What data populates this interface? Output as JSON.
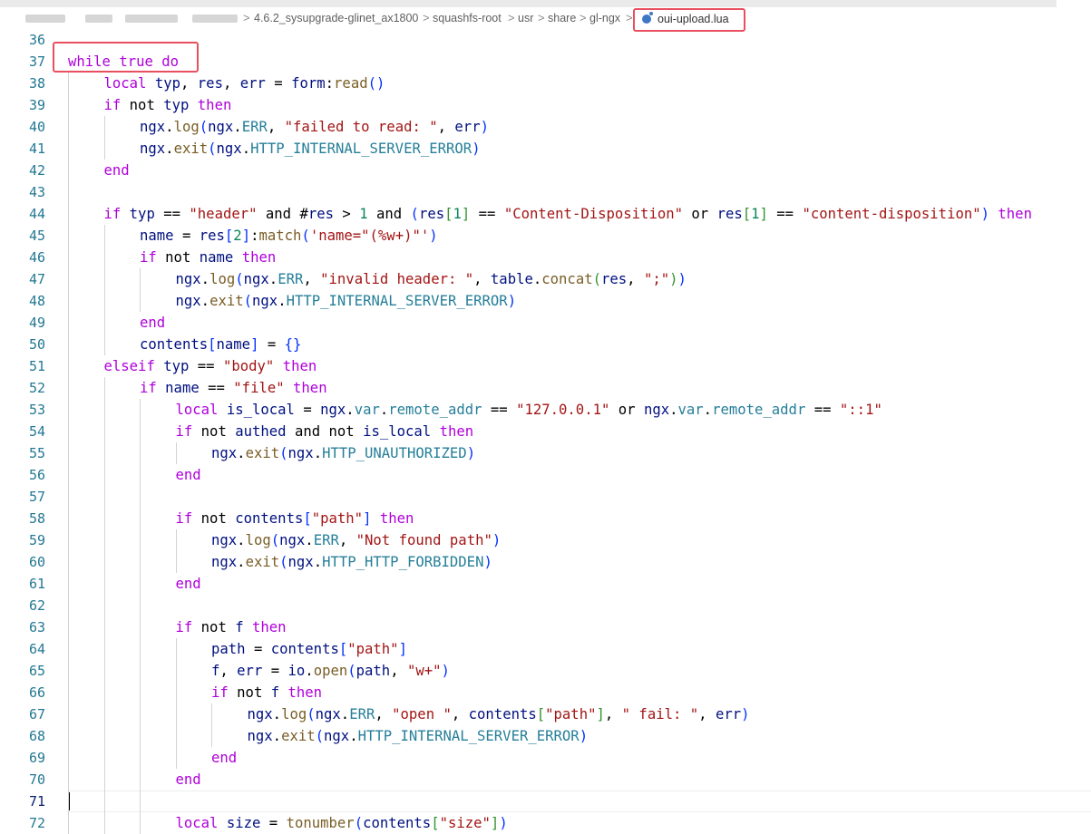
{
  "breadcrumb": {
    "items": [
      "4.6.2_sysupgrade-glinet_ax1800",
      "squashfs-root",
      "usr",
      "share",
      "gl-ngx"
    ],
    "file": "oui-upload.lua",
    "separator": ">"
  },
  "editor": {
    "active_line": 71,
    "highlighted_code": "while true do",
    "lines": [
      {
        "n": 36,
        "indent": 0,
        "t": []
      },
      {
        "n": 37,
        "indent": 0,
        "t": [
          [
            "kw",
            "while"
          ],
          [
            "op",
            " "
          ],
          [
            "kw",
            "true"
          ],
          [
            "op",
            " "
          ],
          [
            "kw",
            "do"
          ]
        ]
      },
      {
        "n": 38,
        "indent": 1,
        "t": [
          [
            "kw",
            "local"
          ],
          [
            "var",
            " typ"
          ],
          [
            "op",
            ", "
          ],
          [
            "var",
            "res"
          ],
          [
            "op",
            ", "
          ],
          [
            "var",
            "err"
          ],
          [
            "op",
            " = "
          ],
          [
            "var",
            "form"
          ],
          [
            "op",
            ":"
          ],
          [
            "fn",
            "read"
          ],
          [
            "br1",
            "()"
          ]
        ]
      },
      {
        "n": 39,
        "indent": 1,
        "t": [
          [
            "kw",
            "if"
          ],
          [
            "op",
            " not "
          ],
          [
            "var",
            "typ"
          ],
          [
            "op",
            " "
          ],
          [
            "kw",
            "then"
          ]
        ]
      },
      {
        "n": 40,
        "indent": 2,
        "t": [
          [
            "var",
            "ngx"
          ],
          [
            "op",
            "."
          ],
          [
            "fn",
            "log"
          ],
          [
            "br1",
            "("
          ],
          [
            "var",
            "ngx"
          ],
          [
            "op",
            "."
          ],
          [
            "fld",
            "ERR"
          ],
          [
            "op",
            ", "
          ],
          [
            "str",
            "\"failed to read: \""
          ],
          [
            "op",
            ", "
          ],
          [
            "var",
            "err"
          ],
          [
            "br1",
            ")"
          ]
        ]
      },
      {
        "n": 41,
        "indent": 2,
        "t": [
          [
            "var",
            "ngx"
          ],
          [
            "op",
            "."
          ],
          [
            "fn",
            "exit"
          ],
          [
            "br1",
            "("
          ],
          [
            "var",
            "ngx"
          ],
          [
            "op",
            "."
          ],
          [
            "fld",
            "HTTP_INTERNAL_SERVER_ERROR"
          ],
          [
            "br1",
            ")"
          ]
        ]
      },
      {
        "n": 42,
        "indent": 1,
        "t": [
          [
            "kw",
            "end"
          ]
        ]
      },
      {
        "n": 43,
        "indent": 0,
        "t": []
      },
      {
        "n": 44,
        "indent": 1,
        "t": [
          [
            "kw",
            "if"
          ],
          [
            "var",
            " typ"
          ],
          [
            "op",
            " == "
          ],
          [
            "str",
            "\"header\""
          ],
          [
            "op",
            " and #"
          ],
          [
            "var",
            "res"
          ],
          [
            "op",
            " > "
          ],
          [
            "num",
            "1"
          ],
          [
            "op",
            " and "
          ],
          [
            "br1",
            "("
          ],
          [
            "var",
            "res"
          ],
          [
            "br2",
            "["
          ],
          [
            "num",
            "1"
          ],
          [
            "br2",
            "]"
          ],
          [
            "op",
            " == "
          ],
          [
            "str",
            "\"Content-Disposition\""
          ],
          [
            "op",
            " or "
          ],
          [
            "var",
            "res"
          ],
          [
            "br2",
            "["
          ],
          [
            "num",
            "1"
          ],
          [
            "br2",
            "]"
          ],
          [
            "op",
            " == "
          ],
          [
            "str",
            "\"content-disposition\""
          ],
          [
            "br1",
            ")"
          ],
          [
            "op",
            " "
          ],
          [
            "kw",
            "then"
          ]
        ]
      },
      {
        "n": 45,
        "indent": 2,
        "t": [
          [
            "var",
            "name"
          ],
          [
            "op",
            " = "
          ],
          [
            "var",
            "res"
          ],
          [
            "br1",
            "["
          ],
          [
            "num",
            "2"
          ],
          [
            "br1",
            "]"
          ],
          [
            "op",
            ":"
          ],
          [
            "fn",
            "match"
          ],
          [
            "br1",
            "("
          ],
          [
            "str",
            "'name=\"(%w+)\"'"
          ],
          [
            "br1",
            ")"
          ]
        ]
      },
      {
        "n": 46,
        "indent": 2,
        "t": [
          [
            "kw",
            "if"
          ],
          [
            "op",
            " not "
          ],
          [
            "var",
            "name"
          ],
          [
            "op",
            " "
          ],
          [
            "kw",
            "then"
          ]
        ]
      },
      {
        "n": 47,
        "indent": 3,
        "t": [
          [
            "var",
            "ngx"
          ],
          [
            "op",
            "."
          ],
          [
            "fn",
            "log"
          ],
          [
            "br1",
            "("
          ],
          [
            "var",
            "ngx"
          ],
          [
            "op",
            "."
          ],
          [
            "fld",
            "ERR"
          ],
          [
            "op",
            ", "
          ],
          [
            "str",
            "\"invalid header: \""
          ],
          [
            "op",
            ", "
          ],
          [
            "var",
            "table"
          ],
          [
            "op",
            "."
          ],
          [
            "fn",
            "concat"
          ],
          [
            "br2",
            "("
          ],
          [
            "var",
            "res"
          ],
          [
            "op",
            ", "
          ],
          [
            "str",
            "\";\""
          ],
          [
            "br2",
            ")"
          ],
          [
            "br1",
            ")"
          ]
        ]
      },
      {
        "n": 48,
        "indent": 3,
        "t": [
          [
            "var",
            "ngx"
          ],
          [
            "op",
            "."
          ],
          [
            "fn",
            "exit"
          ],
          [
            "br1",
            "("
          ],
          [
            "var",
            "ngx"
          ],
          [
            "op",
            "."
          ],
          [
            "fld",
            "HTTP_INTERNAL_SERVER_ERROR"
          ],
          [
            "br1",
            ")"
          ]
        ]
      },
      {
        "n": 49,
        "indent": 2,
        "t": [
          [
            "kw",
            "end"
          ]
        ]
      },
      {
        "n": 50,
        "indent": 2,
        "t": [
          [
            "var",
            "contents"
          ],
          [
            "br1",
            "["
          ],
          [
            "var",
            "name"
          ],
          [
            "br1",
            "]"
          ],
          [
            "op",
            " = "
          ],
          [
            "br1",
            "{}"
          ]
        ]
      },
      {
        "n": 51,
        "indent": 1,
        "t": [
          [
            "kw",
            "elseif"
          ],
          [
            "var",
            " typ"
          ],
          [
            "op",
            " == "
          ],
          [
            "str",
            "\"body\""
          ],
          [
            "op",
            " "
          ],
          [
            "kw",
            "then"
          ]
        ]
      },
      {
        "n": 52,
        "indent": 2,
        "t": [
          [
            "kw",
            "if"
          ],
          [
            "var",
            " name"
          ],
          [
            "op",
            " == "
          ],
          [
            "str",
            "\"file\""
          ],
          [
            "op",
            " "
          ],
          [
            "kw",
            "then"
          ]
        ]
      },
      {
        "n": 53,
        "indent": 3,
        "t": [
          [
            "kw",
            "local"
          ],
          [
            "var",
            " is_local"
          ],
          [
            "op",
            " = "
          ],
          [
            "var",
            "ngx"
          ],
          [
            "op",
            "."
          ],
          [
            "fld",
            "var"
          ],
          [
            "op",
            "."
          ],
          [
            "fld",
            "remote_addr"
          ],
          [
            "op",
            " == "
          ],
          [
            "str",
            "\"127.0.0.1\""
          ],
          [
            "op",
            " or "
          ],
          [
            "var",
            "ngx"
          ],
          [
            "op",
            "."
          ],
          [
            "fld",
            "var"
          ],
          [
            "op",
            "."
          ],
          [
            "fld",
            "remote_addr"
          ],
          [
            "op",
            " == "
          ],
          [
            "str",
            "\"::1\""
          ]
        ]
      },
      {
        "n": 54,
        "indent": 3,
        "t": [
          [
            "kw",
            "if"
          ],
          [
            "op",
            " not "
          ],
          [
            "var",
            "authed"
          ],
          [
            "op",
            " and not "
          ],
          [
            "var",
            "is_local"
          ],
          [
            "op",
            " "
          ],
          [
            "kw",
            "then"
          ]
        ]
      },
      {
        "n": 55,
        "indent": 4,
        "t": [
          [
            "var",
            "ngx"
          ],
          [
            "op",
            "."
          ],
          [
            "fn",
            "exit"
          ],
          [
            "br1",
            "("
          ],
          [
            "var",
            "ngx"
          ],
          [
            "op",
            "."
          ],
          [
            "fld",
            "HTTP_UNAUTHORIZED"
          ],
          [
            "br1",
            ")"
          ]
        ]
      },
      {
        "n": 56,
        "indent": 3,
        "t": [
          [
            "kw",
            "end"
          ]
        ]
      },
      {
        "n": 57,
        "indent": 0,
        "t": []
      },
      {
        "n": 58,
        "indent": 3,
        "t": [
          [
            "kw",
            "if"
          ],
          [
            "op",
            " not "
          ],
          [
            "var",
            "contents"
          ],
          [
            "br1",
            "["
          ],
          [
            "str",
            "\"path\""
          ],
          [
            "br1",
            "]"
          ],
          [
            "op",
            " "
          ],
          [
            "kw",
            "then"
          ]
        ]
      },
      {
        "n": 59,
        "indent": 4,
        "t": [
          [
            "var",
            "ngx"
          ],
          [
            "op",
            "."
          ],
          [
            "fn",
            "log"
          ],
          [
            "br1",
            "("
          ],
          [
            "var",
            "ngx"
          ],
          [
            "op",
            "."
          ],
          [
            "fld",
            "ERR"
          ],
          [
            "op",
            ", "
          ],
          [
            "str",
            "\"Not found path\""
          ],
          [
            "br1",
            ")"
          ]
        ]
      },
      {
        "n": 60,
        "indent": 4,
        "t": [
          [
            "var",
            "ngx"
          ],
          [
            "op",
            "."
          ],
          [
            "fn",
            "exit"
          ],
          [
            "br1",
            "("
          ],
          [
            "var",
            "ngx"
          ],
          [
            "op",
            "."
          ],
          [
            "fld",
            "HTTP_HTTP_FORBIDDEN"
          ],
          [
            "br1",
            ")"
          ]
        ]
      },
      {
        "n": 61,
        "indent": 3,
        "t": [
          [
            "kw",
            "end"
          ]
        ]
      },
      {
        "n": 62,
        "indent": 0,
        "t": []
      },
      {
        "n": 63,
        "indent": 3,
        "t": [
          [
            "kw",
            "if"
          ],
          [
            "op",
            " not "
          ],
          [
            "var",
            "f"
          ],
          [
            "op",
            " "
          ],
          [
            "kw",
            "then"
          ]
        ]
      },
      {
        "n": 64,
        "indent": 4,
        "t": [
          [
            "var",
            "path"
          ],
          [
            "op",
            " = "
          ],
          [
            "var",
            "contents"
          ],
          [
            "br1",
            "["
          ],
          [
            "str",
            "\"path\""
          ],
          [
            "br1",
            "]"
          ]
        ]
      },
      {
        "n": 65,
        "indent": 4,
        "t": [
          [
            "var",
            "f"
          ],
          [
            "op",
            ", "
          ],
          [
            "var",
            "err"
          ],
          [
            "op",
            " = "
          ],
          [
            "var",
            "io"
          ],
          [
            "op",
            "."
          ],
          [
            "fn",
            "open"
          ],
          [
            "br1",
            "("
          ],
          [
            "var",
            "path"
          ],
          [
            "op",
            ", "
          ],
          [
            "str",
            "\"w+\""
          ],
          [
            "br1",
            ")"
          ]
        ]
      },
      {
        "n": 66,
        "indent": 4,
        "t": [
          [
            "kw",
            "if"
          ],
          [
            "op",
            " not "
          ],
          [
            "var",
            "f"
          ],
          [
            "op",
            " "
          ],
          [
            "kw",
            "then"
          ]
        ]
      },
      {
        "n": 67,
        "indent": 5,
        "t": [
          [
            "var",
            "ngx"
          ],
          [
            "op",
            "."
          ],
          [
            "fn",
            "log"
          ],
          [
            "br1",
            "("
          ],
          [
            "var",
            "ngx"
          ],
          [
            "op",
            "."
          ],
          [
            "fld",
            "ERR"
          ],
          [
            "op",
            ", "
          ],
          [
            "str",
            "\"open \""
          ],
          [
            "op",
            ", "
          ],
          [
            "var",
            "contents"
          ],
          [
            "br2",
            "["
          ],
          [
            "str",
            "\"path\""
          ],
          [
            "br2",
            "]"
          ],
          [
            "op",
            ", "
          ],
          [
            "str",
            "\" fail: \""
          ],
          [
            "op",
            ", "
          ],
          [
            "var",
            "err"
          ],
          [
            "br1",
            ")"
          ]
        ]
      },
      {
        "n": 68,
        "indent": 5,
        "t": [
          [
            "var",
            "ngx"
          ],
          [
            "op",
            "."
          ],
          [
            "fn",
            "exit"
          ],
          [
            "br1",
            "("
          ],
          [
            "var",
            "ngx"
          ],
          [
            "op",
            "."
          ],
          [
            "fld",
            "HTTP_INTERNAL_SERVER_ERROR"
          ],
          [
            "br1",
            ")"
          ]
        ]
      },
      {
        "n": 69,
        "indent": 4,
        "t": [
          [
            "kw",
            "end"
          ]
        ]
      },
      {
        "n": 70,
        "indent": 3,
        "t": [
          [
            "kw",
            "end"
          ]
        ]
      },
      {
        "n": 71,
        "indent": 0,
        "t": []
      },
      {
        "n": 72,
        "indent": 3,
        "t": [
          [
            "kw",
            "local"
          ],
          [
            "var",
            " size"
          ],
          [
            "op",
            " = "
          ],
          [
            "fn",
            "tonumber"
          ],
          [
            "br1",
            "("
          ],
          [
            "var",
            "contents"
          ],
          [
            "br2",
            "["
          ],
          [
            "str",
            "\"size\""
          ],
          [
            "br2",
            "]"
          ],
          [
            "br1",
            ")"
          ]
        ]
      }
    ]
  }
}
